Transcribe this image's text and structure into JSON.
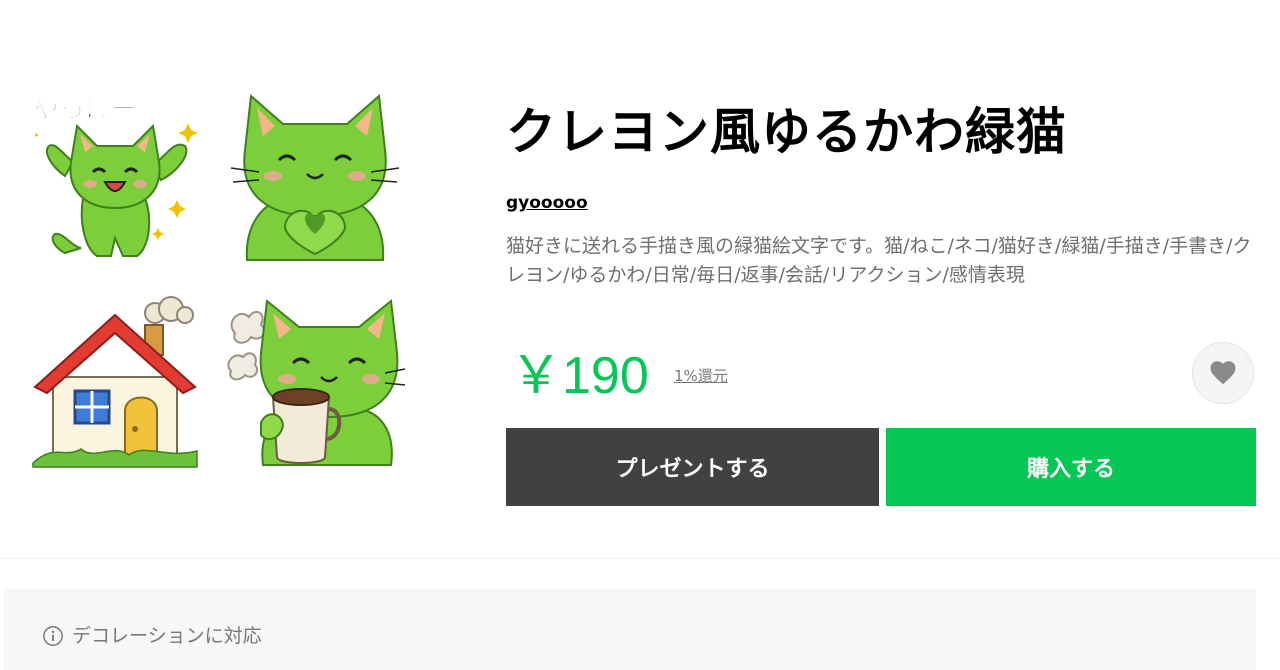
{
  "product": {
    "title": "クレヨン風ゆるかわ緑猫",
    "author": "gyooooo",
    "description": "猫好きに送れる手描き風の緑猫絵文字です。猫/ねこ/ネコ/猫好き/緑猫/手描き/手書き/クレヨン/ゆるかわ/日常/毎日/返事/会話/リアクション/感情表現",
    "price": "￥190",
    "cashback": "1%還元"
  },
  "thumbnails": [
    {
      "icon": "waving-cat-yahho-sticker",
      "caption": "やっほー"
    },
    {
      "icon": "heart-hands-cat-sticker"
    },
    {
      "icon": "house-sticker"
    },
    {
      "icon": "coffee-cat-sticker"
    }
  ],
  "actions": {
    "gift_label": "プレゼントする",
    "buy_label": "購入する",
    "favorite_icon": "heart-icon"
  },
  "notice": {
    "text": "デコレーションに対応"
  },
  "colors": {
    "price": "#06c755",
    "buy_button": "#06c755",
    "gift_button": "#414141",
    "cat_green": "#7ccf3b"
  }
}
